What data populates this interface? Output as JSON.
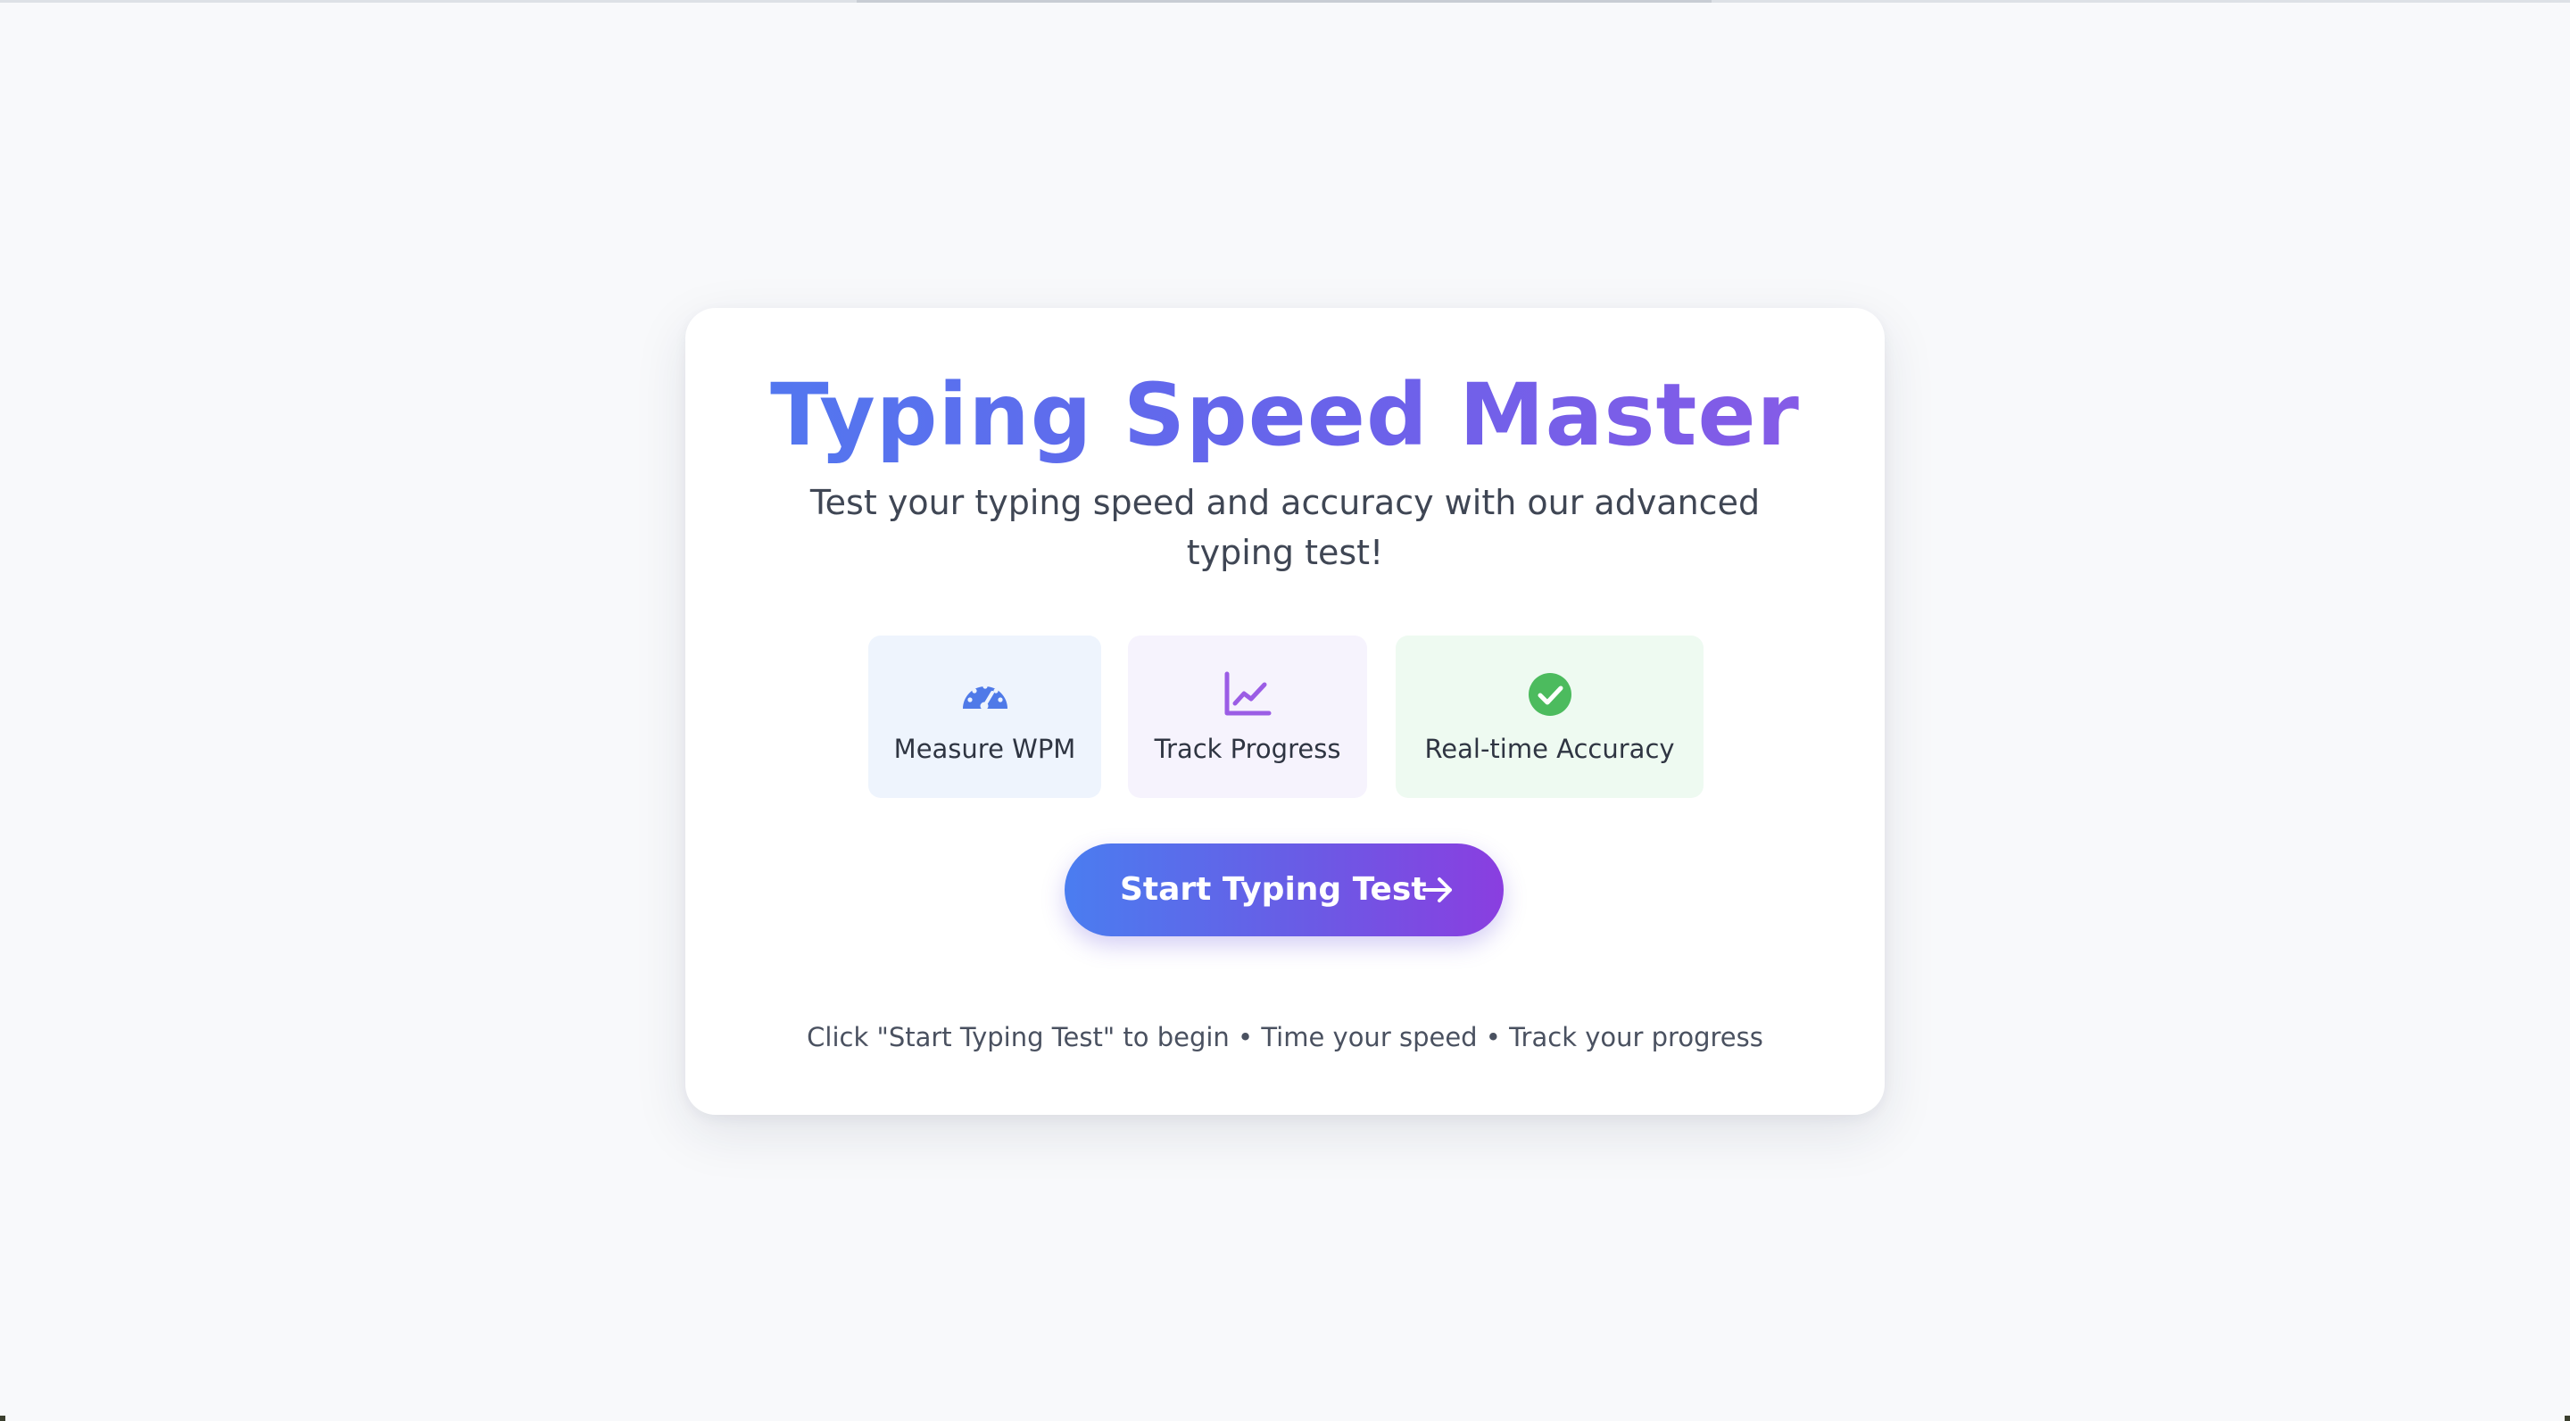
{
  "app": {
    "title": "Typing Speed Master",
    "subtitle": "Test your typing speed and accuracy with our advanced typing test!"
  },
  "features": [
    {
      "label": "Measure WPM",
      "icon": "gauge-icon",
      "color": "#4f7ae8",
      "bg": "#eef4fd"
    },
    {
      "label": "Track Progress",
      "icon": "line-chart-icon",
      "color": "#9b5de5",
      "bg": "#f6f3fd"
    },
    {
      "label": "Real-time Accuracy",
      "icon": "check-circle-icon",
      "color": "#4cbb5e",
      "bg": "#eefaf1"
    }
  ],
  "start_button": {
    "label": "Start Typing Test",
    "icon": "arrow-right-icon"
  },
  "hint": "Click \"Start Typing Test\" to begin • Time your speed • Track your progress",
  "colors": {
    "page_bg": "#f8f9fb",
    "card_bg": "#ffffff",
    "accent_start": "#4a7df0",
    "accent_end": "#8a3ee0",
    "text": "#3f4654"
  }
}
